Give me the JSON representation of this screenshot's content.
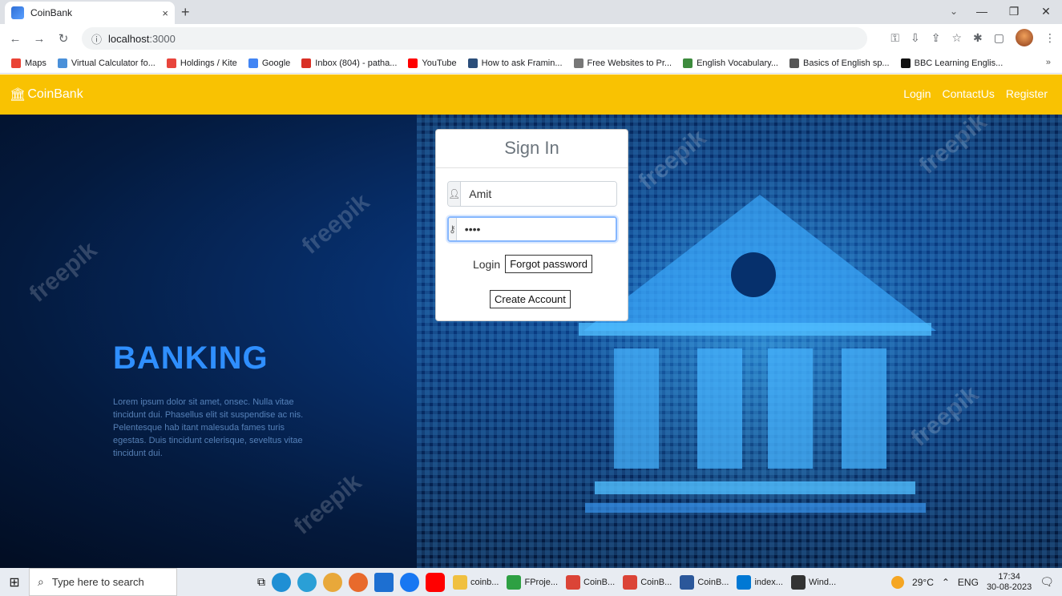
{
  "browser": {
    "tab_title": "CoinBank",
    "tab_close": "×",
    "new_tab": "+",
    "url_host": "localhost",
    "url_port": ":3000",
    "bookmarks": [
      {
        "label": "Maps",
        "color": "#ea4335"
      },
      {
        "label": "Virtual Calculator fo...",
        "color": "#4a90d9"
      },
      {
        "label": "Holdings / Kite",
        "color": "#e8453c"
      },
      {
        "label": "Google",
        "color": "#4285f4"
      },
      {
        "label": "Inbox (804) - patha...",
        "color": "#d93025"
      },
      {
        "label": "YouTube",
        "color": "#ff0000"
      },
      {
        "label": "How to ask Framin...",
        "color": "#2b4e7a"
      },
      {
        "label": "Free Websites to Pr...",
        "color": "#777777"
      },
      {
        "label": "English Vocabulary...",
        "color": "#3d8b3d"
      },
      {
        "label": "Basics of English sp...",
        "color": "#555555"
      },
      {
        "label": "BBC Learning Englis...",
        "color": "#111111"
      }
    ],
    "bookmarks_more": "»"
  },
  "navbar": {
    "brand": "CoinBank",
    "links": {
      "login": "Login",
      "contact": "ContactUs",
      "register": "Register"
    }
  },
  "hero": {
    "headline": "BANKING",
    "body": "Lorem ipsum dolor sit amet, onsec. Nulla vitae tincidunt dui. Phasellus elit sit suspendise ac nis. Pelentesque hab itant malesuda fames turis egestas. Duis tincidunt celerisque, seveltus vitae tincidunt dui.",
    "watermark": "freepik"
  },
  "signin": {
    "title": "Sign In",
    "username_value": "Amit",
    "password_value": "••••",
    "login_label": "Login",
    "forgot_label": "Forgot password",
    "create_label": "Create Account"
  },
  "taskbar": {
    "search_placeholder": "Type here to search",
    "apps": [
      {
        "label": "coinb...",
        "color": "#f0c040"
      },
      {
        "label": "FProje...",
        "color": "#2ea043"
      },
      {
        "label": "CoinB...",
        "color": "#db4437"
      },
      {
        "label": "CoinB...",
        "color": "#db4437"
      },
      {
        "label": "CoinB...",
        "color": "#2b579a"
      },
      {
        "label": "index...",
        "color": "#0078d4"
      },
      {
        "label": "Wind...",
        "color": "#333333"
      }
    ],
    "weather": "29°C",
    "lang": "ENG",
    "time": "17:34",
    "date": "30-08-2023"
  },
  "colors": {
    "navbar": "#f9c202",
    "headline": "#2f8fff"
  }
}
